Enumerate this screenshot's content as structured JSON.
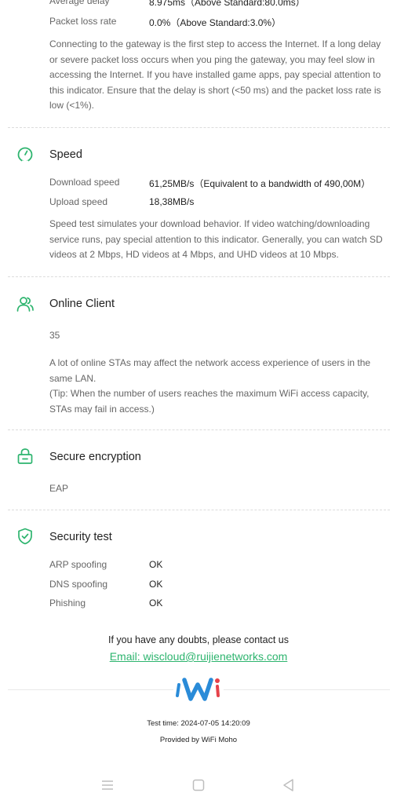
{
  "top": {
    "avg_delay_label": "Average delay",
    "avg_delay_value": "8.975ms（Above Standard:80.0ms）",
    "packet_loss_label": "Packet loss rate",
    "packet_loss_value": "0.0%（Above Standard:3.0%）",
    "description": "Connecting to the gateway is the first step to access the Internet. If a long delay or severe packet loss occurs when you ping the gateway, you may feel slow in accessing the Internet. If you have installed game apps, pay special attention to this indicator. Ensure that the delay is short (<50 ms) and the packet loss rate is low (<1%)."
  },
  "speed": {
    "title": "Speed",
    "download_label": "Download speed",
    "download_value": "61,25MB/s（Equivalent to a bandwidth of 490,00M）",
    "upload_label": "Upload speed",
    "upload_value": "18,38MB/s",
    "description": "Speed test simulates your download behavior. If video watching/downloading service runs, pay special attention to this indicator. Generally, you can watch SD videos at 2 Mbps, HD videos at 4 Mbps, and UHD videos at 10 Mbps."
  },
  "online_client": {
    "title": "Online Client",
    "count": "35",
    "description_1": "A lot of online STAs may affect the network access experience of users in the same LAN.",
    "description_2": "(Tip: When the number of users reaches the maximum WiFi access capacity, STAs may fail in access.)"
  },
  "secure_encryption": {
    "title": "Secure encryption",
    "value": "EAP"
  },
  "security_test": {
    "title": "Security test",
    "rows": [
      {
        "label": "ARP spoofing",
        "value": "OK"
      },
      {
        "label": "DNS spoofing",
        "value": "OK"
      },
      {
        "label": "Phishing",
        "value": "OK"
      }
    ]
  },
  "contact": {
    "text": "If you have any doubts, please contact us",
    "email": "Email: wiscloud@ruijienetworks.com"
  },
  "footer": {
    "test_time": "Test time: 2024-07-05 14:20:09",
    "provided_by": "Provided by WiFi Moho"
  },
  "colors": {
    "accent": "#2db46e",
    "logo_blue": "#2a8bd8",
    "logo_red": "#e6424a",
    "muted_text": "#666666"
  },
  "icons": {
    "speed": "speedometer-icon",
    "online_client": "users-icon",
    "secure_encryption": "lock-icon",
    "security_test": "shield-check-icon",
    "nav_menu": "menu-icon",
    "nav_home": "square-home-icon",
    "nav_back": "triangle-back-icon"
  }
}
